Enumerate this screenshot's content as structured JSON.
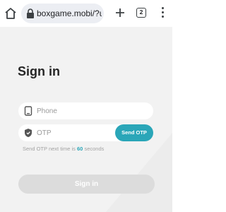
{
  "browser": {
    "url": "boxgame.mobi/?us",
    "tab_count": "2",
    "icons": [
      "home-icon",
      "lock-icon",
      "plus-icon",
      "tab-switcher-icon",
      "more-vert-icon"
    ]
  },
  "signin": {
    "title": "Sign in",
    "phone_placeholder": "Phone",
    "otp_placeholder": "OTP",
    "send_otp_label": "Send OTP",
    "hint_prefix": "Send OTP next time is",
    "hint_seconds": "60",
    "hint_suffix": "seconds",
    "submit_label": "Sign in",
    "accent_color": "#2aa6b8",
    "field_icons": [
      "phone-icon",
      "shield-icon"
    ]
  }
}
